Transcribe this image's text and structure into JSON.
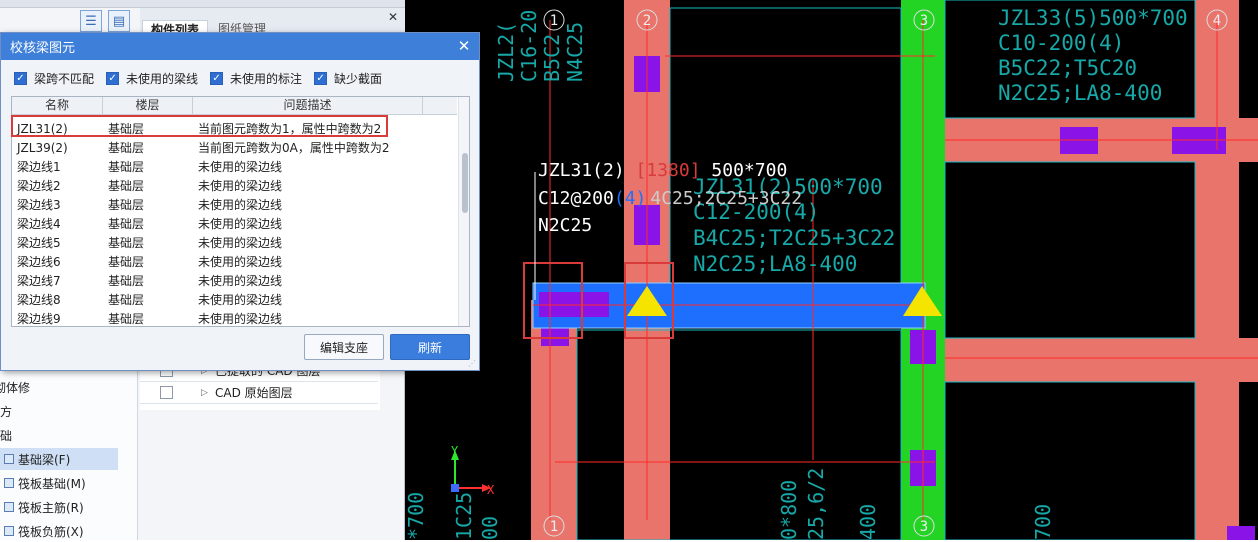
{
  "toolbar": {
    "view_list_icon": "list-view-icon",
    "view_grid_icon": "table-view-icon"
  },
  "component_tabs": [
    {
      "label": "构件列表"
    },
    {
      "label": "图纸管理"
    }
  ],
  "layers": {
    "rows": [
      {
        "label": "已提取的 CAD 图层"
      },
      {
        "label": "CAD 原始图层"
      }
    ]
  },
  "side_tree": {
    "items": [
      {
        "label": "砌体修",
        "full_hint": ""
      },
      {
        "label": "土方"
      },
      {
        "label": "基础"
      },
      {
        "label": "基础梁(F)",
        "selected": true
      },
      {
        "label": "筏板基础(M)"
      },
      {
        "label": "筏板主筋(R)"
      },
      {
        "label": "筏板负筋(X)"
      }
    ]
  },
  "dialog": {
    "title": "校核梁图元",
    "close_icon": "close-icon",
    "filters": [
      {
        "label": "梁跨不匹配",
        "checked": true
      },
      {
        "label": "未使用的梁线",
        "checked": true
      },
      {
        "label": "未使用的标注",
        "checked": true
      },
      {
        "label": "缺少截面",
        "checked": true
      }
    ],
    "table": {
      "columns": [
        "名称",
        "楼层",
        "问题描述"
      ],
      "rows": [
        {
          "name": "JZL31(2)",
          "floor": "基础层",
          "issue": "当前图元跨数为1，属性中跨数为2"
        },
        {
          "name": "JZL39(2)",
          "floor": "基础层",
          "issue": "当前图元跨数为0A，属性中跨数为2"
        },
        {
          "name": "梁边线1",
          "floor": "基础层",
          "issue": "未使用的梁边线"
        },
        {
          "name": "梁边线2",
          "floor": "基础层",
          "issue": "未使用的梁边线"
        },
        {
          "name": "梁边线3",
          "floor": "基础层",
          "issue": "未使用的梁边线"
        },
        {
          "name": "梁边线4",
          "floor": "基础层",
          "issue": "未使用的梁边线"
        },
        {
          "name": "梁边线5",
          "floor": "基础层",
          "issue": "未使用的梁边线"
        },
        {
          "name": "梁边线6",
          "floor": "基础层",
          "issue": "未使用的梁边线"
        },
        {
          "name": "梁边线7",
          "floor": "基础层",
          "issue": "未使用的梁边线"
        },
        {
          "name": "梁边线8",
          "floor": "基础层",
          "issue": "未使用的梁边线"
        },
        {
          "name": "梁边线9",
          "floor": "基础层",
          "issue": "未使用的梁边线"
        }
      ]
    },
    "buttons": {
      "edit_support": "编辑支座",
      "refresh": "刷新"
    }
  },
  "cad": {
    "axis_labels": [
      "1",
      "2",
      "3",
      "4",
      "1",
      "3"
    ],
    "beam_label": {
      "line1_name": "JZL31(2)",
      "line1_span": "[1380]",
      "line1_size": "500*700",
      "line2_a": "C12@200",
      "line2_b": "(4)",
      "line2_c": "4C25;2C25+3C22",
      "line3": "N2C25"
    },
    "cad_text_right": [
      "JZL33(5)500*700",
      "C10-200(4)",
      "B5C22;T5C20",
      "N2C25;LA8-400"
    ],
    "cad_text_mid": [
      "JZL31(2)500*700",
      "C12-200(4)",
      "B4C25;T2C25+3C22",
      "N2C25;LA8-400"
    ],
    "cad_text_left_vertical": [
      "JZL2(",
      "C16-20",
      "B5C2",
      "N4C25"
    ],
    "cad_text_bottom": [
      "0*800",
      "25,6/2",
      "400",
      "700"
    ],
    "cad_text_bottom_left": [
      "1C25",
      "00",
      "*700"
    ],
    "ucs": {
      "y": "Y",
      "x": "X"
    },
    "colors": {
      "background": "#000000",
      "beam_pink": "#e8746c",
      "column_green": "#24d424",
      "selected_beam": "#1f6fff",
      "column_purple": "#8a14e8",
      "support_marker": "#f5e400",
      "cad_text": "#17a8a8",
      "highlight_box": "#d93a3a"
    }
  }
}
